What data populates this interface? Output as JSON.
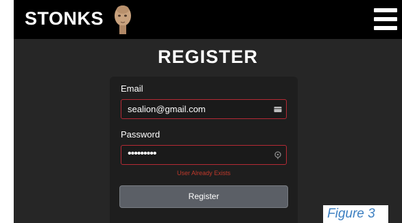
{
  "navbar": {
    "brand": "STONKS",
    "logo_icon": "meme-man-head-icon",
    "menu_icon": "hamburger-menu-icon"
  },
  "page": {
    "title": "REGISTER"
  },
  "form": {
    "email_label": "Email",
    "email_value": "sealion@gmail.com",
    "email_icon": "autofill-card-icon",
    "password_label": "Password",
    "password_value": "•••••••••",
    "password_icon": "autofill-key-icon",
    "error_message": "User Already Exists",
    "submit_label": "Register"
  },
  "caption": "Figure 3",
  "colors": {
    "background": "#262626",
    "navbar": "#000000",
    "card": "#1e1e1e",
    "error_border": "#b52a35",
    "error_text": "#c0392b",
    "button": "#5b5f66",
    "caption": "#3c7fc1"
  }
}
